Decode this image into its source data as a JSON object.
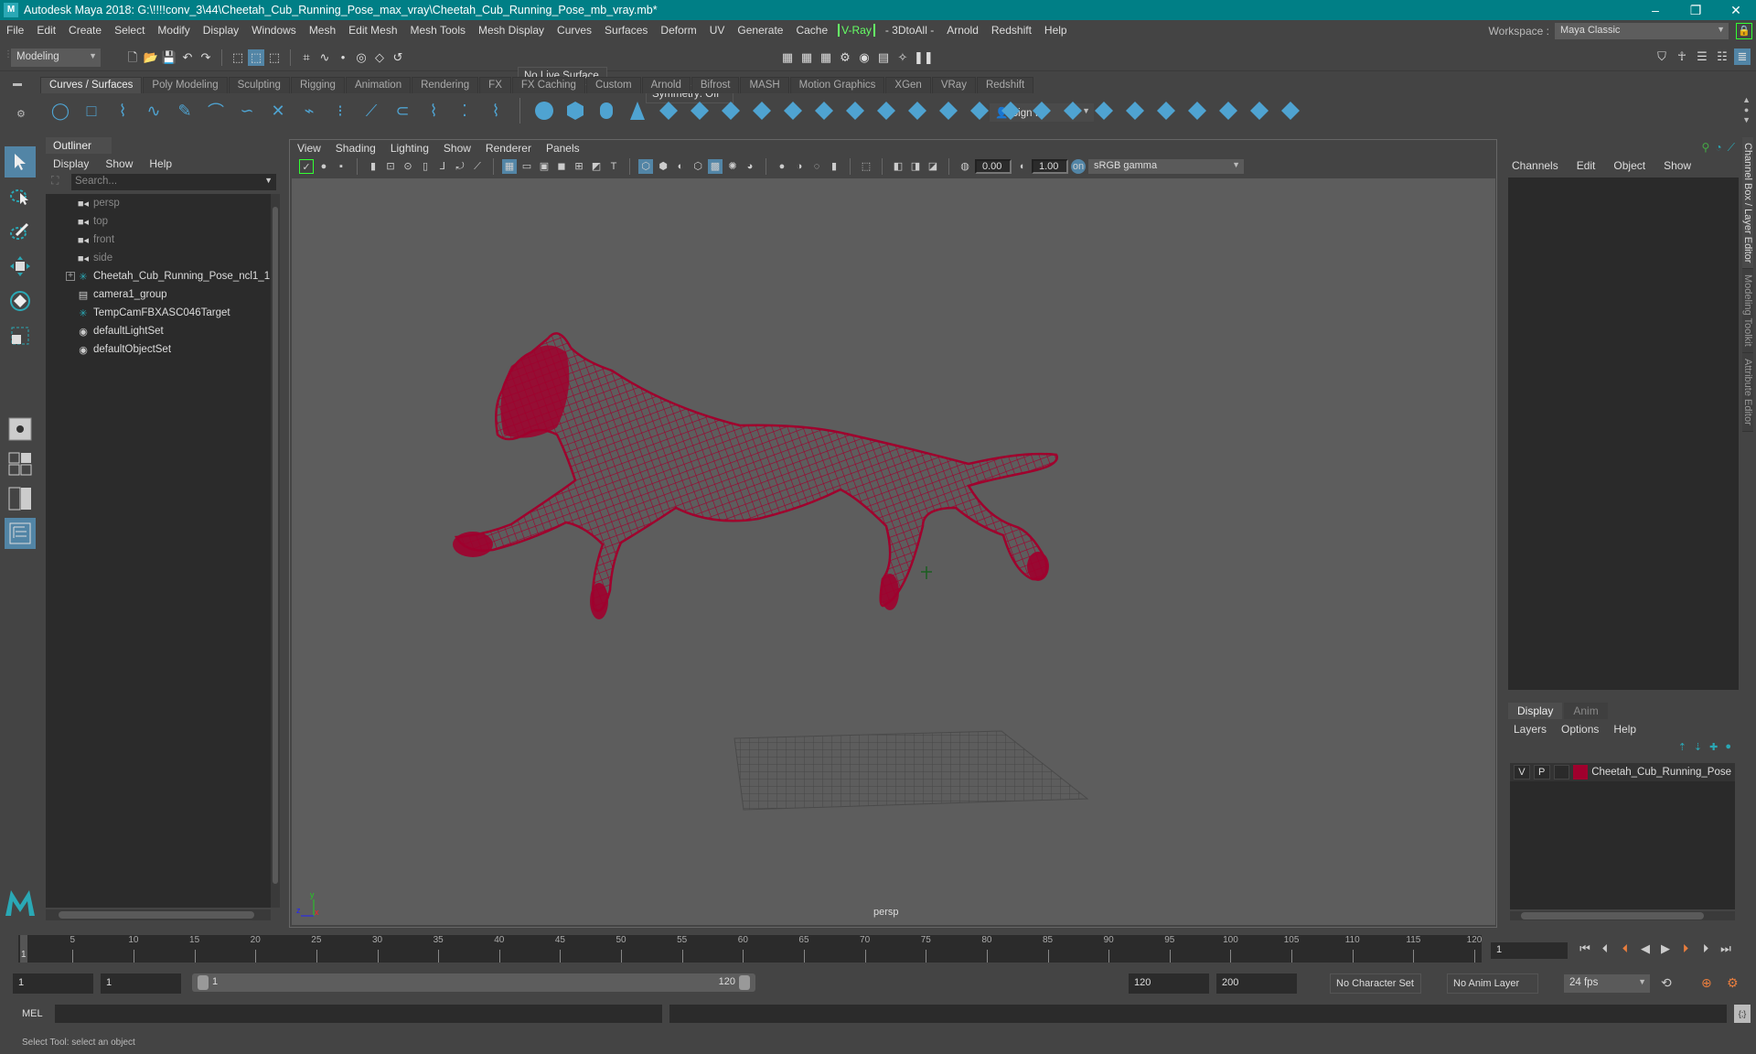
{
  "titlebar": {
    "title": "Autodesk Maya 2018: G:\\!!!!conv_3\\44\\Cheetah_Cub_Running_Pose_max_vray\\Cheetah_Cub_Running_Pose_mb_vray.mb*",
    "minimize": "–",
    "maximize": "❐",
    "close": "✕"
  },
  "menubar": {
    "items": [
      "File",
      "Edit",
      "Create",
      "Select",
      "Modify",
      "Display",
      "Windows",
      "Mesh",
      "Edit Mesh",
      "Mesh Tools",
      "Mesh Display",
      "Curves",
      "Surfaces",
      "Deform",
      "UV",
      "Generate",
      "Cache",
      "V-Ray",
      "- 3DtoAll -",
      "Arnold",
      "Redshift",
      "Help"
    ]
  },
  "workspace": {
    "label": "Workspace :",
    "value": "Maya Classic"
  },
  "statusline": {
    "mode": "Modeling",
    "live_surface": "No Live Surface",
    "symmetry": "Symmetry: Off",
    "sign_in": "Sign In"
  },
  "shelf": {
    "tabs": [
      "Curves / Surfaces",
      "Poly Modeling",
      "Sculpting",
      "Rigging",
      "Animation",
      "Rendering",
      "FX",
      "FX Caching",
      "Custom",
      "Arnold",
      "Bifrost",
      "MASH",
      "Motion Graphics",
      "XGen",
      "VRay",
      "Redshift"
    ],
    "active_tab": "Curves / Surfaces"
  },
  "outliner": {
    "title": "Outliner",
    "menu": [
      "Display",
      "Show",
      "Help"
    ],
    "search_placeholder": "Search...",
    "items": [
      {
        "label": "persp",
        "icon": "camera-icon",
        "dim": true
      },
      {
        "label": "top",
        "icon": "camera-icon",
        "dim": true
      },
      {
        "label": "front",
        "icon": "camera-icon",
        "dim": true
      },
      {
        "label": "side",
        "icon": "camera-icon",
        "dim": true
      },
      {
        "label": "Cheetah_Cub_Running_Pose_ncl1_1",
        "icon": "locator-icon",
        "expandable": true
      },
      {
        "label": "camera1_group",
        "icon": "group-icon"
      },
      {
        "label": "TempCamFBXASC046Target",
        "icon": "locator-icon"
      },
      {
        "label": "defaultLightSet",
        "icon": "set-icon"
      },
      {
        "label": "defaultObjectSet",
        "icon": "set-icon"
      }
    ]
  },
  "viewport": {
    "menu": [
      "View",
      "Shading",
      "Lighting",
      "Show",
      "Renderer",
      "Panels"
    ],
    "exposure": "0.00",
    "gamma": "1.00",
    "color_space": "sRGB gamma",
    "camera_label": "persp",
    "axis": {
      "x": "x",
      "y": "y",
      "z": "z"
    },
    "wire_color": "#a0002d"
  },
  "channelbox": {
    "menu": [
      "Channels",
      "Edit",
      "Object",
      "Show"
    ]
  },
  "side_tabs": [
    "Channel Box / Layer Editor",
    "Modeling Toolkit",
    "Attribute Editor"
  ],
  "layer_editor": {
    "tabs": [
      "Display",
      "Anim"
    ],
    "menu": [
      "Layers",
      "Options",
      "Help"
    ],
    "layers": [
      {
        "v": "V",
        "p": "P",
        "name": "Cheetah_Cub_Running_Pose",
        "color": "#a0002d"
      }
    ]
  },
  "timeline": {
    "ticks": [
      5,
      10,
      15,
      20,
      25,
      30,
      35,
      40,
      45,
      50,
      55,
      60,
      65,
      70,
      75,
      80,
      85,
      90,
      95,
      100,
      105,
      110,
      115,
      120
    ],
    "start": 1,
    "end": 120,
    "current_frame": "1"
  },
  "range": {
    "start_field": "1",
    "playback_start": "1",
    "slider_start": "1",
    "slider_end": "120",
    "playback_end": "120",
    "end_field": "200",
    "character_set": "No Character Set",
    "anim_layer": "No Anim Layer",
    "fps": "24 fps"
  },
  "commandline": {
    "lang": "MEL"
  },
  "status": {
    "help_text": "Select Tool: select an object"
  }
}
